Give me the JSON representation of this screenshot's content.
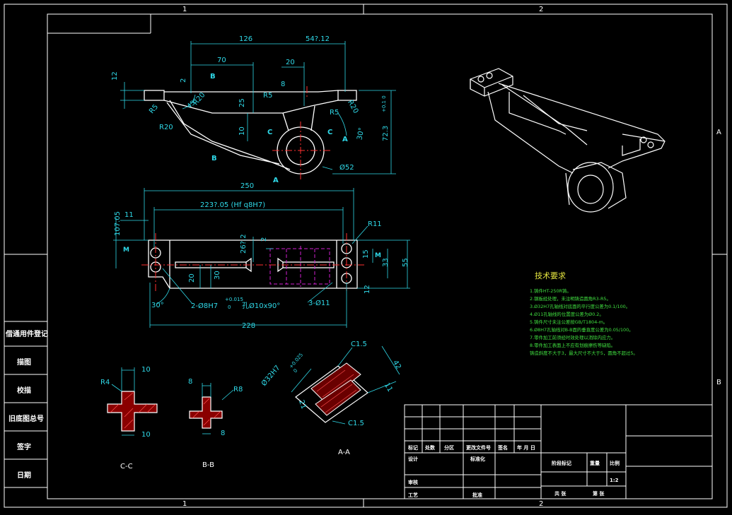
{
  "colors": {
    "background": "#000000",
    "outline": "#ffffff",
    "dimension": "#2fd9e8",
    "centerline": "#ff3030",
    "hidden": "#d020d0",
    "hatch": "#ff4040",
    "note": "#40e040",
    "frame_label": "#ffffff"
  },
  "grid_labels": {
    "top": [
      "1",
      "2"
    ],
    "bottom": [
      "1",
      "2"
    ],
    "right": [
      "A",
      "B"
    ]
  },
  "top_view": {
    "dims": [
      "126",
      "54?.12",
      "70",
      "20",
      "8",
      "12",
      "2",
      "25",
      "10",
      "R5",
      "R5",
      "R5",
      "R20",
      "R20",
      "R20",
      "45°",
      "30°",
      "Ø52",
      "72.3"
    ],
    "tol": "+0.1\n0",
    "section_marks": [
      "B",
      "B",
      "C",
      "C",
      "A",
      "A"
    ]
  },
  "front_view": {
    "dims": [
      "250",
      "223?.05 (Hf q8H7)",
      "11",
      "107.05",
      "26?.2",
      "2",
      "30",
      "20",
      "15",
      "33",
      "55",
      "12",
      "R11",
      "30°",
      "228",
      "2-Ø8H7",
      "孔Ø10x90°",
      "3-Ø11"
    ],
    "tol_upper": "+0.015",
    "tol_lower": "0",
    "marks": [
      "M",
      "M"
    ]
  },
  "sections": {
    "cc": {
      "label": "C-C",
      "dims": [
        "R4",
        "10",
        "10"
      ]
    },
    "bb": {
      "label": "B-B",
      "dims": [
        "8",
        "8",
        "R8"
      ]
    },
    "aa": {
      "label": "A-A",
      "dims": [
        "C1.5",
        "C1.5",
        "Ø32H7",
        "+0.025",
        "0",
        "42",
        "21",
        "11"
      ]
    }
  },
  "tech": {
    "title": "技术要求",
    "notes": [
      "1.铸件HT-250R铸。",
      "2.钢板经处理，未注明铸造圆角R3-R5。",
      "3.Ø32H7孔轴线对底面的平行度公差为0.1/100。",
      "4.Ø11孔轴线的位置度公差为Ø0.2。",
      "5.铸件尺寸未注公差按GB/T1804-m。",
      "6.Ø8H7孔轴线对B-B面的垂直度公差为0.05/100。",
      "7.零件加工前须经时效处理以消除内应力。",
      "8.零件加工表面上不应有划痕擦伤等缺陷。",
      "  铸造斜度不大于3，最大尺寸不大于5，圆角不超过5。"
    ]
  },
  "left_stamps": [
    "借通用件登记",
    "描图",
    "校描",
    "旧底图总号",
    "签字",
    "日期"
  ],
  "title_block": {
    "row_labels": [
      "标记",
      "处数",
      "分区",
      "更改文件号",
      "签名",
      "年 月 日"
    ],
    "design": "设计",
    "standard": "标准化",
    "check": "审核",
    "process": "工艺",
    "approve": "批准",
    "stage": "阶段标记",
    "weight": "重量",
    "scale_label": "比例",
    "scale": "1:2",
    "sheets_total": "共  张",
    "sheet_no": "第  张"
  }
}
